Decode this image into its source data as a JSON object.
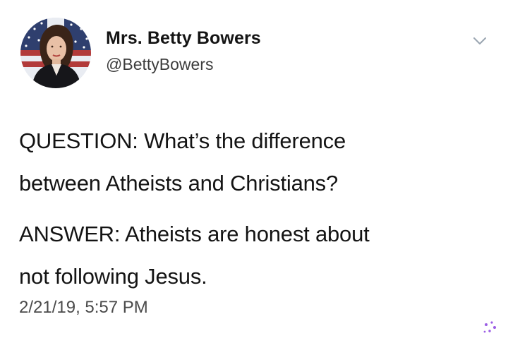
{
  "tweet": {
    "display_name": "Mrs. Betty Bowers",
    "handle": "@BettyBowers",
    "text_paragraphs": [
      [
        "QUESTION: What’s the difference",
        "between Atheists and Christians?"
      ],
      [
        "ANSWER: Atheists are honest about",
        "not following Jesus."
      ]
    ],
    "timestamp": "2/21/19, 5:57 PM",
    "icons": {
      "menu": "chevron-down-icon",
      "watermark": "sparkle-icon"
    },
    "colors": {
      "text": "#141414",
      "secondary": "#3c3c3c",
      "chevron": "#9aa5b1",
      "sparkle": "#9b5de5"
    }
  }
}
